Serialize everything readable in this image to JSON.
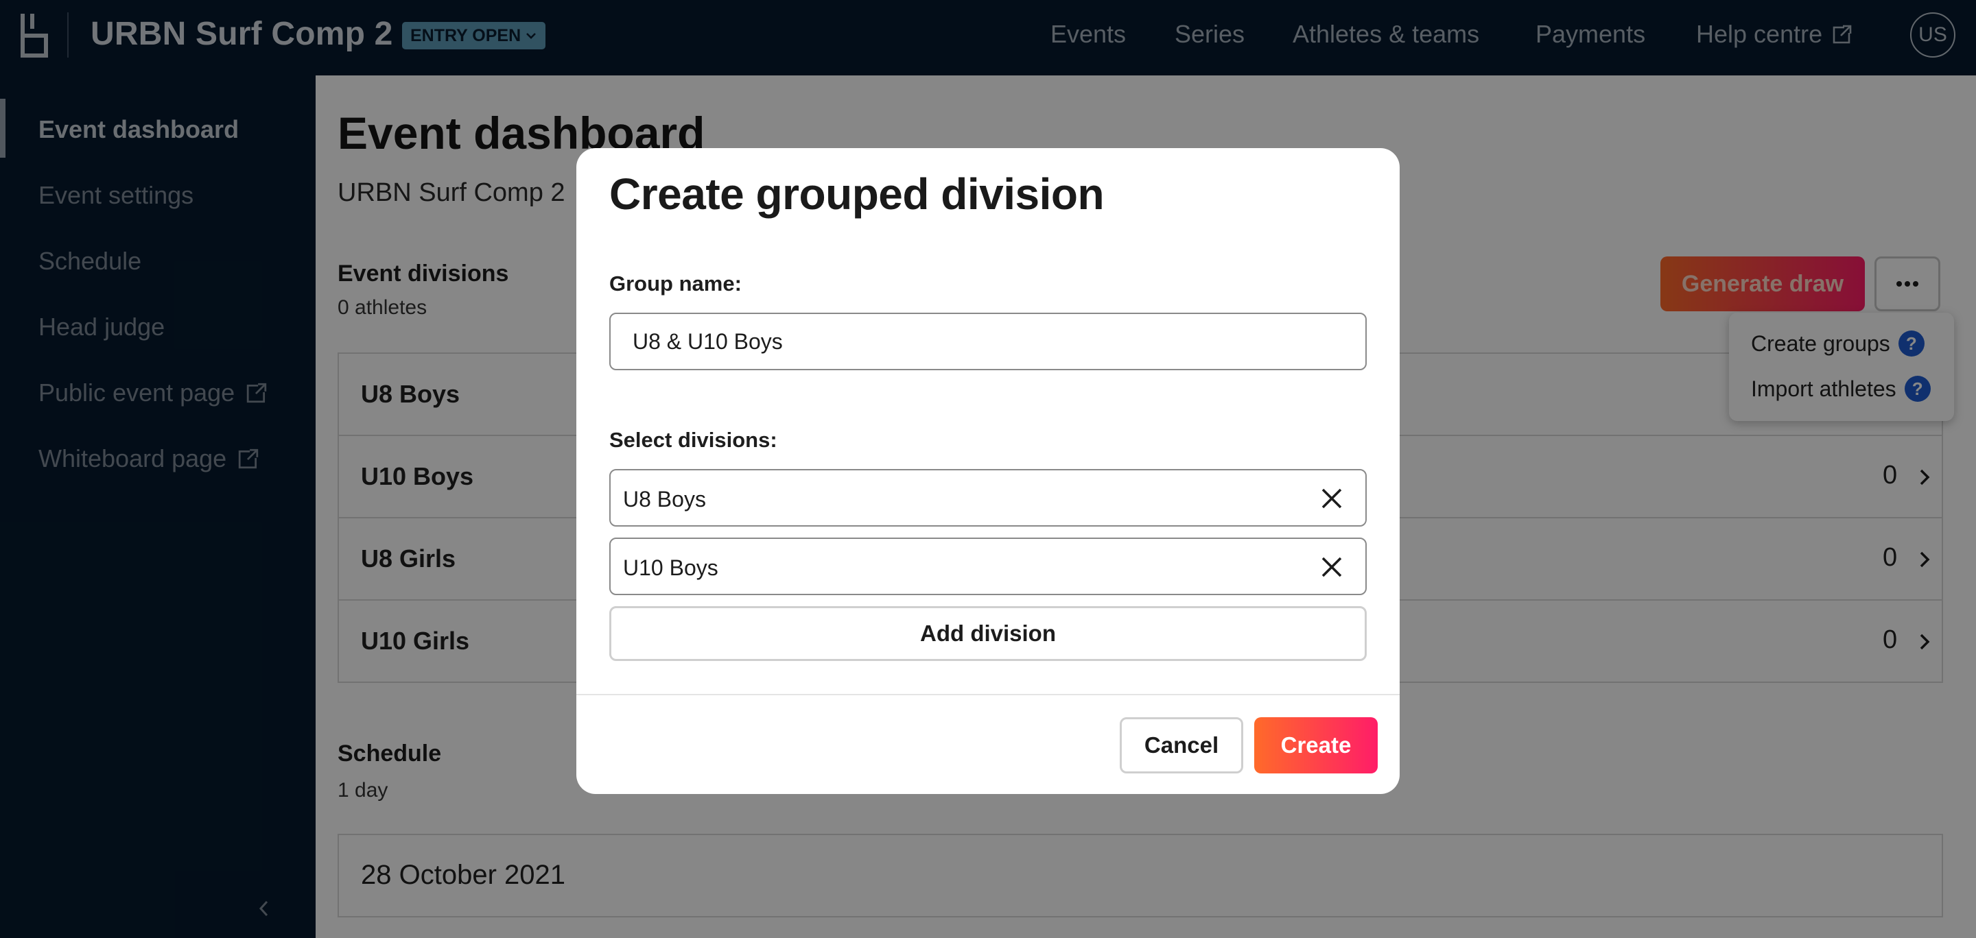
{
  "header": {
    "title": "URBN Surf Comp 2",
    "badge": "ENTRY OPEN",
    "nav": [
      "Events",
      "Series",
      "Athletes & teams",
      "Payments",
      "Help centre"
    ],
    "avatar": "US"
  },
  "sidebar": {
    "items": [
      {
        "label": "Event dashboard",
        "active": true
      },
      {
        "label": "Event settings"
      },
      {
        "label": "Schedule"
      },
      {
        "label": "Head judge"
      },
      {
        "label": "Public event page",
        "icon": "external-link-icon"
      },
      {
        "label": "Whiteboard page",
        "icon": "external-link-icon"
      }
    ]
  },
  "main": {
    "title": "Event dashboard",
    "subtitle": "URBN Surf Comp 2",
    "divisions_title": "Event divisions",
    "divisions_sub": "0 athletes",
    "generate_draw": "Generate draw",
    "divisions": [
      {
        "name": "U8 Boys",
        "count": ""
      },
      {
        "name": "U10 Boys",
        "count": "0"
      },
      {
        "name": "U8 Girls",
        "count": "0"
      },
      {
        "name": "U10 Girls",
        "count": "0"
      }
    ],
    "schedule_title": "Schedule",
    "schedule_sub": "1 day",
    "schedule_date": "28 October 2021"
  },
  "dropdown": {
    "items": [
      "Create groups",
      "Import athletes"
    ],
    "help_glyph": "?"
  },
  "modal": {
    "title": "Create grouped division",
    "group_name_label": "Group name:",
    "group_name_value": "U8 & U10 Boys",
    "select_label": "Select divisions:",
    "selected": [
      "U8 Boys",
      "U10 Boys"
    ],
    "add_division": "Add division",
    "cancel": "Cancel",
    "create": "Create"
  },
  "colors": {
    "navy": "#061a2e",
    "accent_start": "#ff6a2a",
    "accent_end": "#ff1d68",
    "help_blue": "#1f5bd0"
  }
}
